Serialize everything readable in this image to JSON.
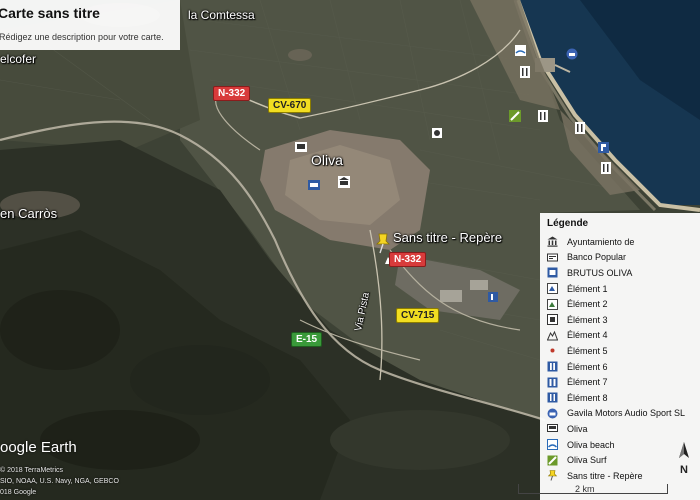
{
  "card": {
    "title": "Carte sans titre",
    "description": "Rédigez une description pour votre carte."
  },
  "places": {
    "comtessa": "la Comtessa",
    "elcofer": "elcofer",
    "oliva": "Oliva",
    "carros": "en Carròs",
    "sans_titre": "Sans titre - Repère",
    "via_pista": "Via Pista"
  },
  "roads": {
    "n332_a": "N-332",
    "cv670": "CV-670",
    "n332_b": "N-332",
    "cv715": "CV-715",
    "ap7": "E-15"
  },
  "legend": {
    "title": "Légende",
    "items": [
      {
        "label": "Ayuntamiento de",
        "icon": "town-hall-icon"
      },
      {
        "label": "Banco Popular",
        "icon": "bank-icon"
      },
      {
        "label": "BRUTUS OLIVA",
        "icon": "shop-icon"
      },
      {
        "label": "Élément 1",
        "icon": "element-1-icon"
      },
      {
        "label": "Élément 2",
        "icon": "element-2-icon"
      },
      {
        "label": "Élément 3",
        "icon": "element-3-icon"
      },
      {
        "label": "Élément 4",
        "icon": "hiking-icon"
      },
      {
        "label": "Élément 5",
        "icon": "dot-icon"
      },
      {
        "label": "Élément 6",
        "icon": "parking-icon"
      },
      {
        "label": "Élément 7",
        "icon": "restroom-icon"
      },
      {
        "label": "Élément 8",
        "icon": "restaurant-icon"
      },
      {
        "label": "Gavila Motors Audio Sport SL",
        "icon": "car-service-icon"
      },
      {
        "label": "Oliva",
        "icon": "train-icon"
      },
      {
        "label": "Oliva beach",
        "icon": "beach-icon"
      },
      {
        "label": "Oliva Surf",
        "icon": "surf-icon"
      },
      {
        "label": "Sans titre - Repère",
        "icon": "pushpin-icon"
      }
    ]
  },
  "footer": {
    "logo": "oogle Earth",
    "credit1": "© 2018 TerraMetrics",
    "credit2": "SIO, NOAA, U.S. Navy, NGA, GEBCO",
    "credit3": "018 Google",
    "scale": "2 km",
    "north": "N"
  },
  "colors": {
    "sea": "#14324a",
    "land_dark": "#34382d",
    "urban": "#8a7f74",
    "road_yellow": "#f2de21",
    "road_red": "#d83b3b"
  }
}
